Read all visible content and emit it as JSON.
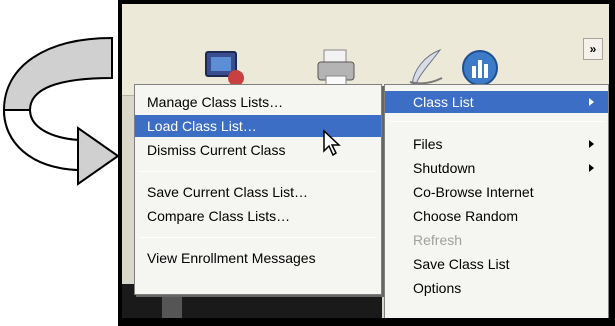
{
  "toolbar": {
    "overflow_label": "»",
    "icons": [
      "monitor-icon",
      "printer-icon",
      "feather-pen-icon",
      "bar-chart-icon"
    ]
  },
  "left_menu": {
    "items": [
      {
        "label": "Manage Class Lists…",
        "highlighted": false
      },
      {
        "label": "Load Class List…",
        "highlighted": true
      },
      {
        "label": "Dismiss Current Class",
        "highlighted": false
      },
      {
        "label": "Save Current Class List…",
        "highlighted": false
      },
      {
        "label": "Compare Class Lists…",
        "highlighted": false
      },
      {
        "label": "View Enrollment Messages",
        "highlighted": false
      }
    ]
  },
  "right_menu": {
    "items": [
      {
        "label": "Class List",
        "highlighted": true,
        "submenu": true
      },
      {
        "label": "Files",
        "submenu": true
      },
      {
        "label": "Shutdown",
        "submenu": true
      },
      {
        "label": "Co-Browse Internet"
      },
      {
        "label": "Choose Random"
      },
      {
        "label": "Refresh",
        "disabled": true
      },
      {
        "label": "Save Class List"
      },
      {
        "label": "Options"
      }
    ]
  },
  "colors": {
    "highlight": "#3d6ec5",
    "menu_bg": "#f5f5f2",
    "toolbar_bg": "#ece9d8",
    "arrow_fill": "#d0d0d0"
  }
}
